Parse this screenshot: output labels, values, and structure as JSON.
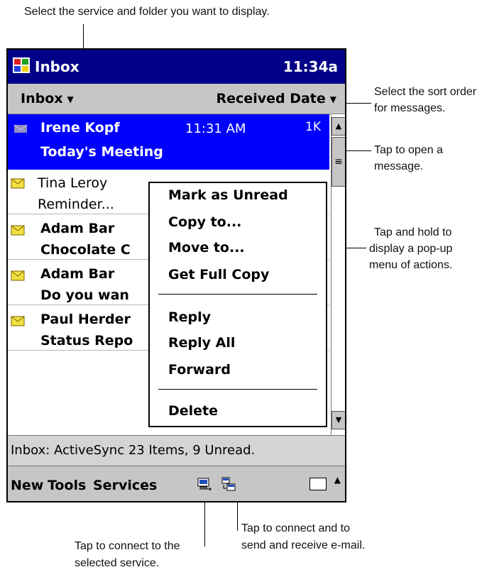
{
  "annotations": {
    "top": "Select the service and folder you want to display.",
    "sort_1": "Select the sort order",
    "sort_2": "for messages.",
    "open_1": "Tap to open a",
    "open_2": "message.",
    "hold_1": "Tap and hold to",
    "hold_2": "display a pop-up",
    "hold_3": "menu of actions.",
    "connect_1": "Tap to connect to the",
    "connect_2": "selected service.",
    "sendrecv_1": "Tap to connect and to",
    "sendrecv_2": "send and receive e-mail."
  },
  "titlebar": {
    "title": "Inbox",
    "time": "11:34a"
  },
  "toolbar": {
    "folder": "Inbox",
    "sort": "Received Date"
  },
  "messages": [
    {
      "sender": "Irene Kopf",
      "time": "11:31 AM",
      "size": "1K",
      "subject": "Today's Meeting",
      "selected": true,
      "read": false
    },
    {
      "sender": "Tina Leroy",
      "subject": "Reminder...",
      "selected": false,
      "read": true
    },
    {
      "sender": "Adam Bar",
      "subject": "Chocolate C",
      "selected": false,
      "read": false
    },
    {
      "sender": "Adam Bar",
      "subject": "Do you wan",
      "selected": false,
      "read": false
    },
    {
      "sender": "Paul Herder",
      "subject": "Status Repo",
      "selected": false,
      "read": false
    }
  ],
  "context_menu": {
    "mark_unread": "Mark as Unread",
    "copy_to": "Copy to...",
    "move_to": "Move to...",
    "get_full_copy": "Get Full Copy",
    "reply": "Reply",
    "reply_all": "Reply All",
    "forward": "Forward",
    "delete": "Delete"
  },
  "status": {
    "text": "Inbox: ActiveSync  23 Items, 9 Unread."
  },
  "menubar": {
    "new": "New",
    "tools": "Tools",
    "services": "Services"
  },
  "icons": [
    "windows-flag-icon",
    "envelope-icon",
    "connect-icon",
    "send-receive-icon",
    "keyboard-icon"
  ],
  "colors": {
    "title_bg": "#000088",
    "selection": "#0000ff",
    "bar_gray": "#c6c6c6"
  }
}
